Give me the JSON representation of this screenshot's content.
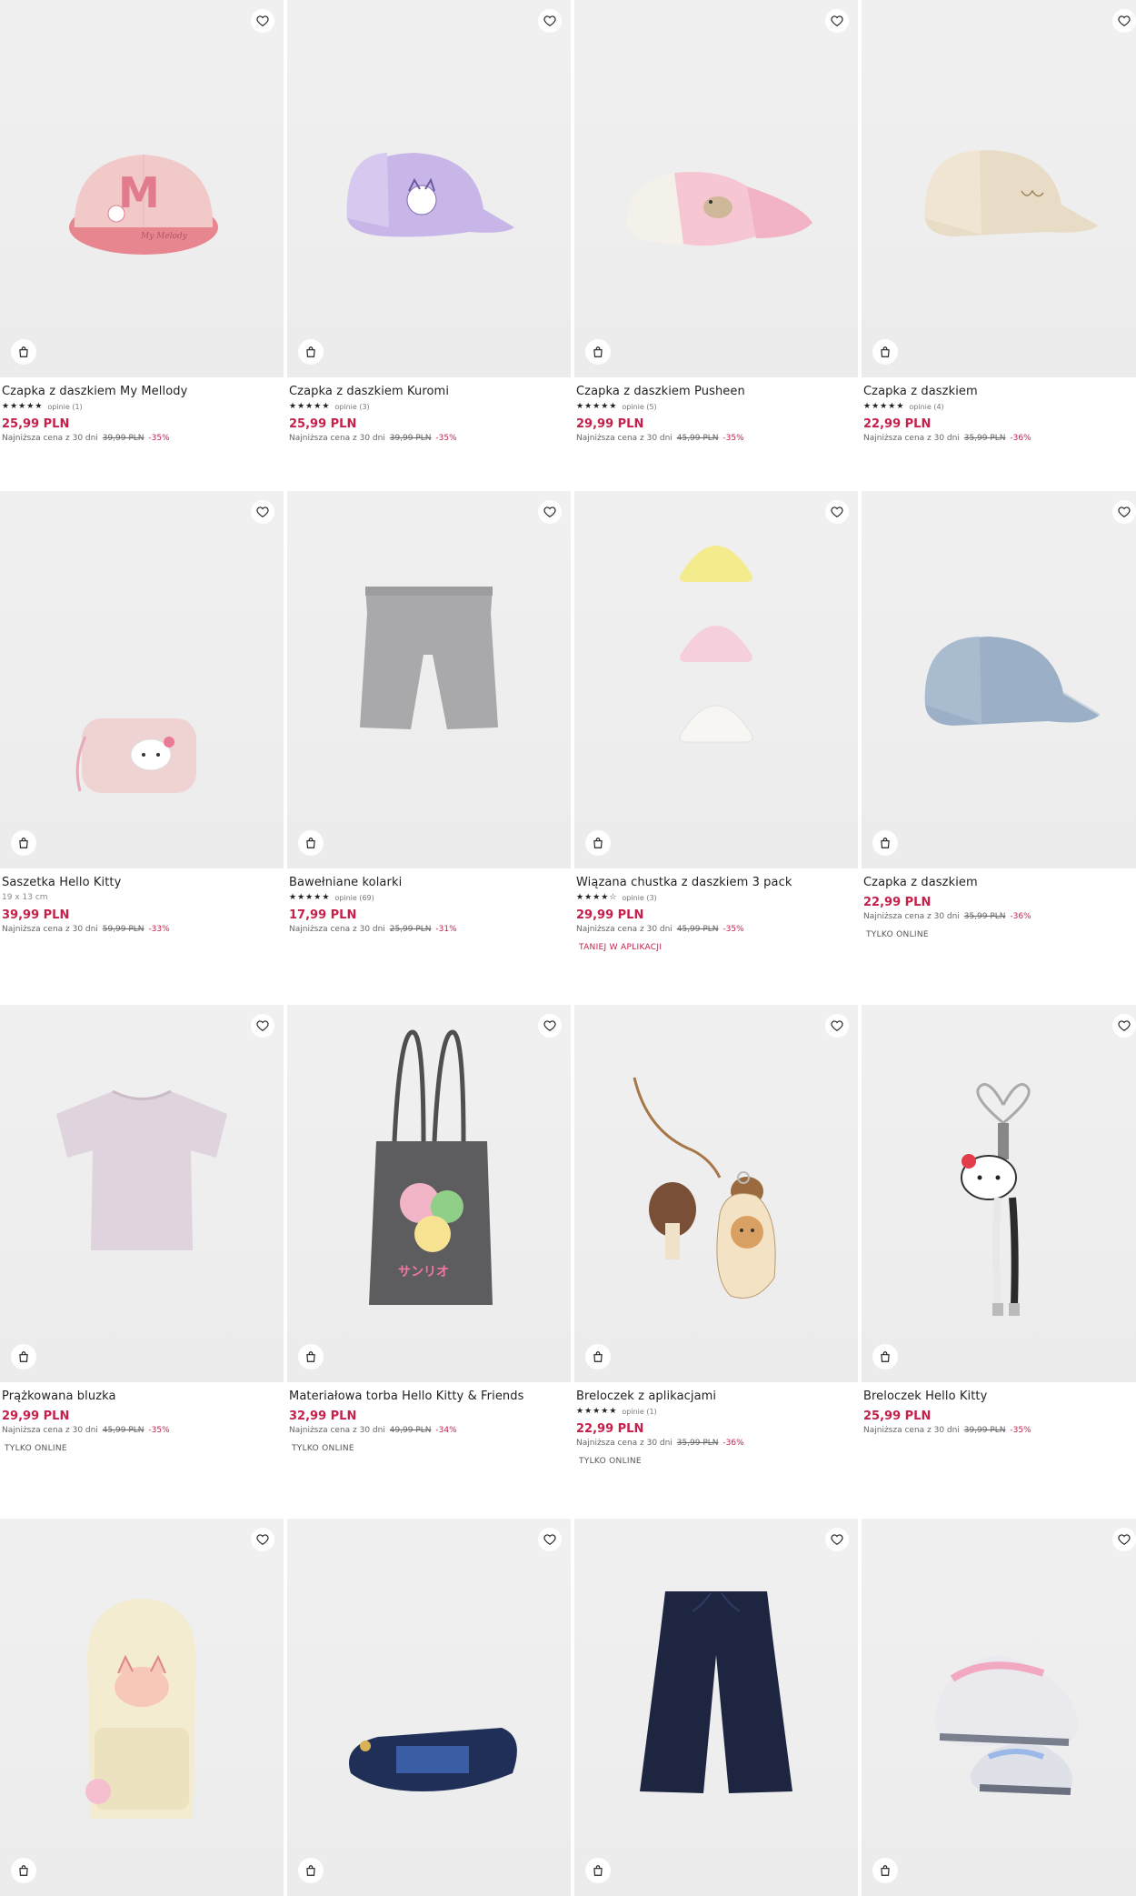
{
  "products": [
    {
      "name": "Czapka z daszkiem My Mellody",
      "reviews": "opinie (1)",
      "price": "25,99 PLN",
      "lowest_label": "Najniższa cena z 30 dni",
      "old_price": "39,99 PLN",
      "discount": "-35%"
    },
    {
      "name": "Czapka z daszkiem Kuromi",
      "reviews": "opinie (3)",
      "price": "25,99 PLN",
      "lowest_label": "Najniższa cena z 30 dni",
      "old_price": "39,99 PLN",
      "discount": "-35%"
    },
    {
      "name": "Czapka z daszkiem Pusheen",
      "reviews": "opinie (5)",
      "price": "29,99 PLN",
      "lowest_label": "Najniższa cena z 30 dni",
      "old_price": "45,99 PLN",
      "discount": "-35%"
    },
    {
      "name": "Czapka z daszkiem",
      "reviews": "opinie (4)",
      "price": "22,99 PLN",
      "lowest_label": "Najniższa cena z 30 dni",
      "old_price": "35,99 PLN",
      "discount": "-36%"
    },
    {
      "name": "Saszetka Hello Kitty",
      "size": "19 x 13 cm",
      "price": "39,99 PLN",
      "lowest_label": "Najniższa cena z 30 dni",
      "old_price": "59,99 PLN",
      "discount": "-33%"
    },
    {
      "name": "Bawełniane kolarki",
      "reviews": "opinie (69)",
      "price": "17,99 PLN",
      "lowest_label": "Najniższa cena z 30 dni",
      "old_price": "25,99 PLN",
      "discount": "-31%"
    },
    {
      "name": "Wiązana chustka z daszkiem 3 pack",
      "reviews": "opinie (3)",
      "price": "29,99 PLN",
      "lowest_label": "Najniższa cena z 30 dni",
      "old_price": "45,99 PLN",
      "discount": "-35%",
      "tag": "TANIEJ W APLIKACJI"
    },
    {
      "name": "Czapka z daszkiem",
      "price": "22,99 PLN",
      "lowest_label": "Najniższa cena z 30 dni",
      "old_price": "35,99 PLN",
      "discount": "-36%",
      "tag": "TYLKO ONLINE"
    },
    {
      "name": "Prążkowana bluzka",
      "price": "29,99 PLN",
      "lowest_label": "Najniższa cena z 30 dni",
      "old_price": "45,99 PLN",
      "discount": "-35%",
      "tag": "TYLKO ONLINE"
    },
    {
      "name": "Materiałowa torba Hello Kitty & Friends",
      "price": "32,99 PLN",
      "lowest_label": "Najniższa cena z 30 dni",
      "old_price": "49,99 PLN",
      "discount": "-34%",
      "tag": "TYLKO ONLINE"
    },
    {
      "name": "Breloczek z aplikacjami",
      "reviews": "opinie (1)",
      "price": "22,99 PLN",
      "lowest_label": "Najniższa cena z 30 dni",
      "old_price": "35,99 PLN",
      "discount": "-36%",
      "tag": "TYLKO ONLINE"
    },
    {
      "name": "Breloczek Hello Kitty",
      "price": "25,99 PLN",
      "lowest_label": "Najniższa cena z 30 dni",
      "old_price": "39,99 PLN",
      "discount": "-35%"
    },
    {},
    {},
    {},
    {}
  ],
  "icons": {
    "wishlist": "heart-icon",
    "add_to_cart": "shopping-bag-icon",
    "rating": "star-icon"
  },
  "colors": {
    "price": "#c51f4a",
    "discount": "#c51f4a",
    "background": "#efefef"
  }
}
